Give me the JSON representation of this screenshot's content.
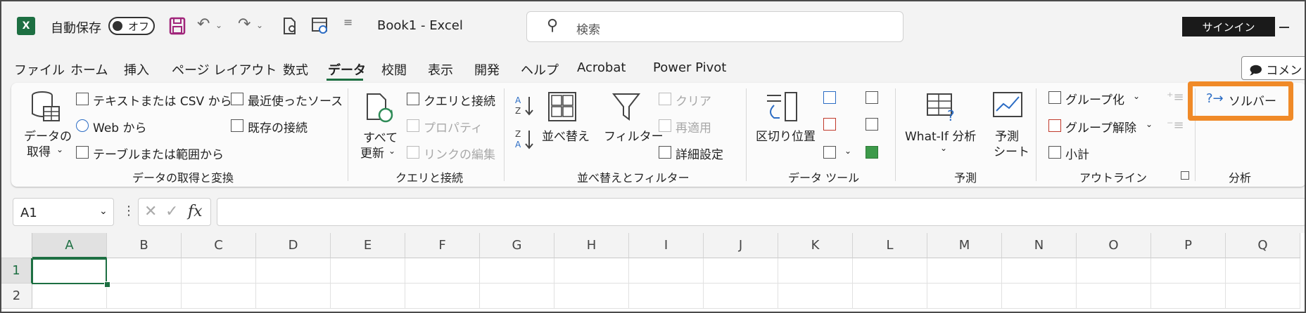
{
  "titlebar": {
    "autosave_label": "自動保存",
    "autosave_state": "オフ",
    "book_title": "Book1  -  Excel",
    "search_placeholder": "検索",
    "signin": "サインイン",
    "app_logo": "X"
  },
  "tabs": [
    {
      "label": "ファイル"
    },
    {
      "label": "ホーム"
    },
    {
      "label": "挿入"
    },
    {
      "label": "ページ レイアウト"
    },
    {
      "label": "数式"
    },
    {
      "label": "データ"
    },
    {
      "label": "校閲"
    },
    {
      "label": "表示"
    },
    {
      "label": "開発"
    },
    {
      "label": "ヘルプ"
    },
    {
      "label": "Acrobat"
    },
    {
      "label": "Power Pivot"
    }
  ],
  "comment_button": "コメント",
  "ribbon": {
    "get_data": {
      "get_data_line1": "データの",
      "get_data_line2": "取得",
      "from_text_csv": "テキストまたは CSV から",
      "from_web": "Web から",
      "from_table": "テーブルまたは範囲から",
      "recent_sources": "最近使ったソース",
      "existing_connections": "既存の接続",
      "group_label": "データの取得と変換"
    },
    "queries": {
      "refresh_all_line1": "すべて",
      "refresh_all_line2": "更新",
      "queries_connections": "クエリと接続",
      "properties": "プロパティ",
      "edit_links": "リンクの編集",
      "group_label": "クエリと接続"
    },
    "sort_filter": {
      "sort_az": "A Z",
      "sort_za": "Z A",
      "sort": "並べ替え",
      "filter": "フィルター",
      "clear": "クリア",
      "reapply": "再適用",
      "advanced": "詳細設定",
      "group_label": "並べ替えとフィルター"
    },
    "data_tools": {
      "text_to_columns": "区切り位置",
      "group_label": "データ ツール"
    },
    "forecast": {
      "what_if": "What-If 分析",
      "forecast_sheet_line1": "予測",
      "forecast_sheet_line2": "シート",
      "group_label": "予測"
    },
    "outline": {
      "group": "グループ化",
      "ungroup": "グループ解除",
      "subtotal": "小計",
      "group_label": "アウトライン"
    },
    "analysis": {
      "solver": "ソルバー",
      "group_label": "分析"
    }
  },
  "formula_bar": {
    "name_box": "A1",
    "fx": "fx",
    "cancel": "✕",
    "enter": "✓",
    "formula": ""
  },
  "grid": {
    "columns": [
      "A",
      "B",
      "C",
      "D",
      "E",
      "F",
      "G",
      "H",
      "I",
      "J",
      "K",
      "L",
      "M",
      "N",
      "O",
      "P",
      "Q"
    ],
    "rows": [
      "1",
      "2"
    ]
  },
  "colors": {
    "accent": "#1d6f42",
    "highlight": "#f08a28"
  }
}
